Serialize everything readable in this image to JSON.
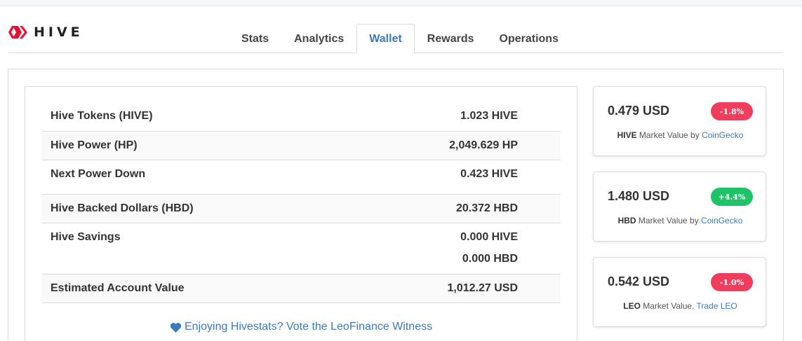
{
  "brand": {
    "name": "HIVE",
    "color": "#e31337"
  },
  "tabs": [
    {
      "label": "Stats",
      "active": false
    },
    {
      "label": "Analytics",
      "active": false
    },
    {
      "label": "Wallet",
      "active": true
    },
    {
      "label": "Rewards",
      "active": false
    },
    {
      "label": "Operations",
      "active": false
    }
  ],
  "wallet": {
    "rows": [
      {
        "label": "Hive Tokens (HIVE)",
        "values": [
          "1.023 HIVE"
        ]
      },
      {
        "label": "Hive Power (HP)",
        "values": [
          "2,049.629 HP"
        ]
      },
      {
        "label": "Next Power Down",
        "values": [
          "0.423 HIVE"
        ]
      },
      {
        "label": "Hive Backed Dollars (HBD)",
        "values": [
          "20.372 HBD"
        ]
      },
      {
        "label": "Hive Savings",
        "values": [
          "0.000 HIVE",
          "0.000 HBD"
        ]
      },
      {
        "label": "Estimated Account Value",
        "values": [
          "1,012.27 USD"
        ]
      }
    ],
    "witness_link": "Enjoying Hivestats? Vote the LeoFinance Witness"
  },
  "markets": [
    {
      "price": "0.479 USD",
      "change": "-1.8%",
      "change_color": "#f03d5e",
      "token": "HIVE",
      "caption": " Market Value by ",
      "link": "CoinGecko"
    },
    {
      "price": "1.480 USD",
      "change": "+4.4%",
      "change_color": "#1ec267",
      "token": "HBD",
      "caption": " Market Value by ",
      "link": "CoinGecko"
    },
    {
      "price": "0.542 USD",
      "change": "-1.0%",
      "change_color": "#f03d5e",
      "token": "LEO",
      "caption": " Market Value. ",
      "link": "Trade LEO"
    }
  ],
  "colors": {
    "link": "#3d7ab8",
    "border": "#dcdcdc"
  }
}
